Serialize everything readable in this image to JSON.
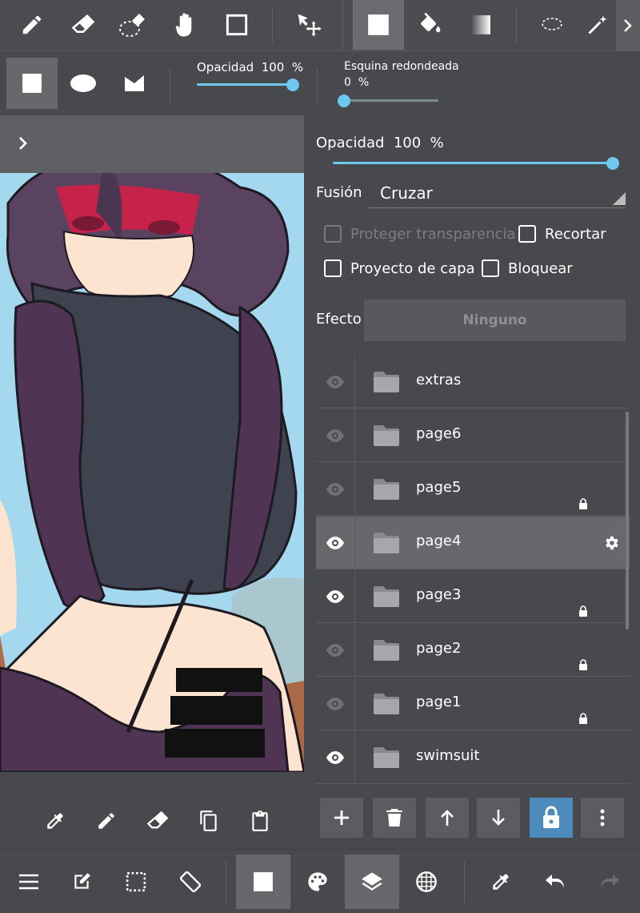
{
  "toolbar": {
    "tools": [
      "pen-icon",
      "eraser-icon",
      "blur-eraser-icon",
      "hand-icon",
      "rectangle-icon",
      "move-icon",
      "fill-shape-icon",
      "bucket-icon",
      "gradient-icon",
      "lasso-icon",
      "magic-wand-icon"
    ],
    "selected": "fill-shape-icon"
  },
  "options": {
    "opacity_label": "Opacidad",
    "opacity_value": "100",
    "opacity_unit": "%",
    "opacity_level": 1.0,
    "corner_label": "Esquina redondeada",
    "corner_value": "0",
    "corner_unit": "%",
    "corner_level": 0.0
  },
  "panel": {
    "opacity_label": "Opacidad",
    "opacity_value": "100",
    "opacity_unit": "%",
    "opacity_level": 1.0,
    "blend_label": "Fusión",
    "blend_value": "Cruzar",
    "protect_label": "Proteger transparencia",
    "clip_label": "Recortar",
    "project_label": "Proyecto de capa",
    "lock_label": "Bloquear",
    "effect_label": "Efecto",
    "effect_value": "Ninguno",
    "layers": [
      {
        "name": "extras",
        "visible": false,
        "locked": false,
        "selected": false
      },
      {
        "name": "page6",
        "visible": false,
        "locked": false,
        "selected": false
      },
      {
        "name": "page5",
        "visible": false,
        "locked": true,
        "selected": false
      },
      {
        "name": "page4",
        "visible": true,
        "locked": false,
        "selected": true
      },
      {
        "name": "page3",
        "visible": true,
        "locked": true,
        "selected": false
      },
      {
        "name": "page2",
        "visible": false,
        "locked": true,
        "selected": false
      },
      {
        "name": "page1",
        "visible": false,
        "locked": true,
        "selected": false
      },
      {
        "name": "swimsuit",
        "visible": true,
        "locked": false,
        "selected": false
      }
    ]
  },
  "colors": {
    "accent": "#6ec7ee",
    "lock_active": "#4d8bbd",
    "background": "#47494c"
  }
}
